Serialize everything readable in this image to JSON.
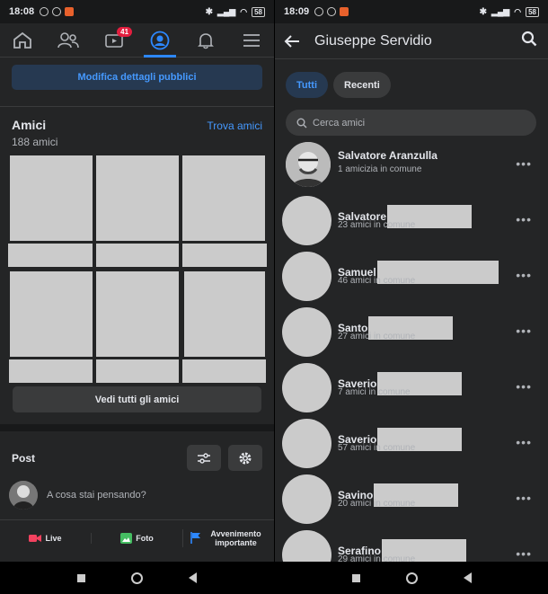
{
  "left": {
    "status": {
      "time": "18:08",
      "battery": "58"
    },
    "nav": {
      "badge": "41"
    },
    "edit_public_label": "Modifica dettagli pubblici",
    "friends": {
      "title": "Amici",
      "count": "188 amici",
      "find_label": "Trova amici",
      "see_all_label": "Vedi tutti gli amici"
    },
    "posts": {
      "title": "Post",
      "placeholder": "A cosa stai pensando?"
    },
    "actions": {
      "live": "Live",
      "photo": "Foto",
      "event": "Avvenimento importante"
    }
  },
  "right": {
    "status": {
      "time": "18:09",
      "battery": "58"
    },
    "header_title": "Giuseppe Servidio",
    "filters": {
      "all": "Tutti",
      "recent": "Recenti"
    },
    "search_placeholder": "Cerca amici",
    "friends": [
      {
        "name": "Salvatore Aranzulla",
        "mutual": "1 amicizia in comune"
      },
      {
        "name": "Salvatore",
        "mutual": "23 amici in comune"
      },
      {
        "name": "Samuel",
        "mutual": "46 amici in comune"
      },
      {
        "name": "Santo",
        "mutual": "27 amici in comune"
      },
      {
        "name": "Saverio",
        "mutual": "7 amici in comune"
      },
      {
        "name": "Saverio",
        "mutual": "57 amici in comune"
      },
      {
        "name": "Savino",
        "mutual": "20 amici in comune"
      },
      {
        "name": "Serafino",
        "mutual": "29 amici in comune"
      }
    ]
  },
  "colors": {
    "accent": "#2d88ff",
    "background": "#242526",
    "masked": "#cbcbcb"
  }
}
